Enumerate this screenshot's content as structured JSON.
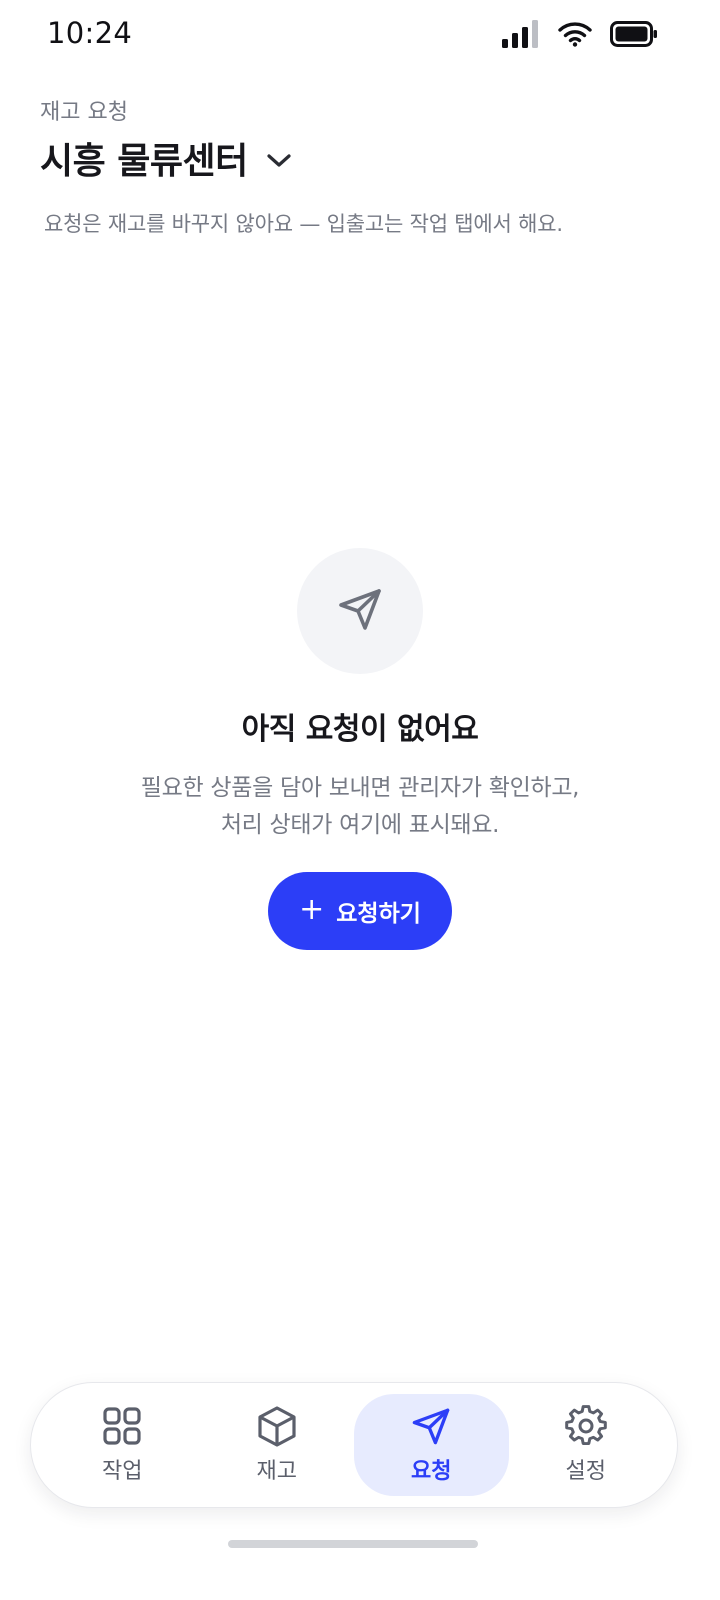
{
  "status_bar": {
    "time": "10:24"
  },
  "header": {
    "eyebrow": "재고 요청",
    "title": "시흥 물류센터",
    "subtitle": "요청은 재고를 바꾸지 않아요 — 입출고는 작업 탭에서 해요."
  },
  "empty_state": {
    "icon": "send-icon",
    "title": "아직 요청이 없어요",
    "description_line1": "필요한 상품을 담아 보내면 관리자가 확인하고,",
    "description_line2": "처리 상태가 여기에 표시돼요.",
    "button_plus": "+",
    "button_label": "요청하기"
  },
  "tab_bar": {
    "tabs": [
      {
        "label": "작업",
        "icon": "grid-icon",
        "active": false
      },
      {
        "label": "재고",
        "icon": "box-icon",
        "active": false
      },
      {
        "label": "요청",
        "icon": "send-icon",
        "active": true
      },
      {
        "label": "설정",
        "icon": "gear-icon",
        "active": false
      }
    ]
  },
  "colors": {
    "accent": "#2c3ef7",
    "accent_soft": "#e7ebfe",
    "text_primary": "#17171c",
    "text_secondary": "#767a85"
  }
}
